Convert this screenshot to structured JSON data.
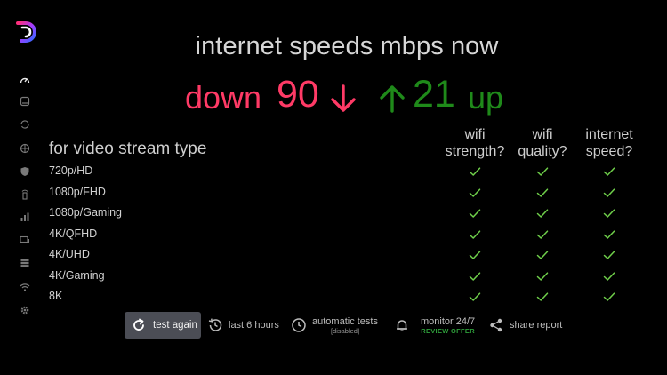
{
  "colors": {
    "down": "#ff3a66",
    "up": "#1f8a1a",
    "check": "#6fcf4a",
    "button_bg": "#4b4d55",
    "offer": "#2e9e3a"
  },
  "sidebar": {
    "items": [
      {
        "name": "speedometer-icon"
      },
      {
        "name": "server-icon"
      },
      {
        "name": "sync-icon"
      },
      {
        "name": "globe-icon"
      },
      {
        "name": "shield-icon"
      },
      {
        "name": "router-icon"
      },
      {
        "name": "bar-chart-icon"
      },
      {
        "name": "devices-icon"
      },
      {
        "name": "list-icon"
      },
      {
        "name": "wifi-icon"
      },
      {
        "name": "gear-icon"
      }
    ]
  },
  "headline": "internet speeds mbps now",
  "speeds": {
    "down_label": "down",
    "down_value": "90",
    "up_value": "21",
    "up_label": "up"
  },
  "table": {
    "title": "for video stream type",
    "columns": [
      {
        "line1": "wifi",
        "line2": "strength?"
      },
      {
        "line1": "wifi",
        "line2": "quality?"
      },
      {
        "line1": "internet",
        "line2": "speed?"
      }
    ],
    "rows": [
      {
        "label": "720p/HD",
        "checks": [
          true,
          true,
          true
        ]
      },
      {
        "label": "1080p/FHD",
        "checks": [
          true,
          true,
          true
        ]
      },
      {
        "label": "1080p/Gaming",
        "checks": [
          true,
          true,
          true
        ]
      },
      {
        "label": "4K/QFHD",
        "checks": [
          true,
          true,
          true
        ]
      },
      {
        "label": "4K/UHD",
        "checks": [
          true,
          true,
          true
        ]
      },
      {
        "label": "4K/Gaming",
        "checks": [
          true,
          true,
          true
        ]
      },
      {
        "label": "8K",
        "checks": [
          true,
          true,
          true
        ]
      }
    ]
  },
  "toolbar": {
    "test_again": "test again",
    "history": "last 6 hours",
    "auto_tests": "automatic tests",
    "auto_tests_status": "[disabled]",
    "monitor": "monitor 24/7",
    "monitor_offer": "REVIEW OFFER",
    "share": "share report"
  }
}
